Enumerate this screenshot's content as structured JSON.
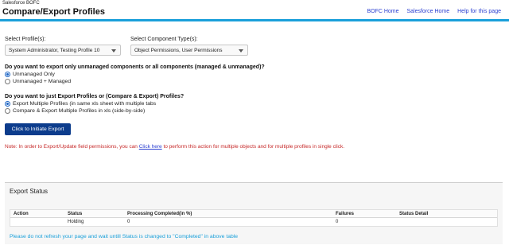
{
  "header": {
    "app_name": "Salesforce BOFC",
    "title": "Compare/Export Profiles",
    "links": [
      "BOFC Home",
      "Salesforce Home",
      "Help for this page"
    ]
  },
  "form": {
    "profile_label": "Select Profile(s):",
    "profile_value": "System Administrator, Testing Profile 10",
    "component_label": "Select Component Type(s):",
    "component_value": "Object Permissions, User Permissions"
  },
  "q1": {
    "text": "Do you want to export only unmanaged components or all components (managed & unmanaged)?",
    "options": [
      "Unmanaged Only",
      "Unmanaged + Managed"
    ],
    "selected": 0
  },
  "q2": {
    "text": "Do you want to just Export Profiles or (Compare & Export) Profiles?",
    "options": [
      "Export Multiple Profiles (in same xls sheet with multiple tabs",
      "Compare & Export Multiple Profiles in xls (side-by-side)"
    ],
    "selected": 0
  },
  "export_button": "Click to Initiate Export",
  "note": {
    "before": "Note: In order to Export/Update field permissions, you can ",
    "link": "Click here",
    "after": " to perform this action for multiple objects and for multiple profiles in single click."
  },
  "status": {
    "title": "Export Status",
    "columns": [
      "Action",
      "Status",
      "Processing Completed(in %)",
      "Failures",
      "Status Detail"
    ],
    "rows": [
      [
        "",
        "Holding",
        "0",
        "0",
        ""
      ]
    ],
    "footer": "Please do not refresh your page and wait untill Status is changed to \"Completed\" in above table"
  },
  "colors": {
    "accent_bar": "#1aa0da",
    "button": "#0c3c8c",
    "note": "#c62828",
    "link": "#2a3fd1"
  }
}
